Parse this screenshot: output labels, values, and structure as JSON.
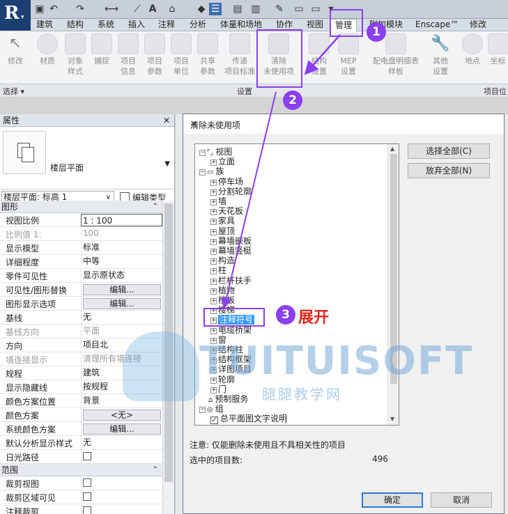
{
  "quick_access": {
    "icons": [
      "app-menu-icon",
      "open-icon",
      "save-icon",
      "undo-icon",
      "redo-icon",
      "measure-icon",
      "dimension-icon",
      "text-icon",
      "3d-view-icon",
      "section-icon",
      "thin-lines-icon",
      "close-hidden-icon",
      "switch-windows-icon",
      "customize-icon"
    ]
  },
  "ribbon_tabs": [
    "建筑",
    "结构",
    "系统",
    "插入",
    "注释",
    "分析",
    "体量和场地",
    "协作",
    "视图",
    "管理",
    "附加模块",
    "Enscape™",
    "修改"
  ],
  "active_tab": "管理",
  "ribbon_tools": [
    {
      "label": "修改"
    },
    {
      "label": "材质"
    },
    {
      "label": "对象\n样式"
    },
    {
      "label": "捕捉"
    },
    {
      "label": "项目\n信息"
    },
    {
      "label": "项目\n参数"
    },
    {
      "label": "项目\n单位"
    },
    {
      "label": "共享\n参数"
    },
    {
      "label": "传递\n项目标准"
    },
    {
      "label": "清除\n未使用项"
    },
    {
      "label": "结构\n设置"
    },
    {
      "label": "MEP\n设置"
    },
    {
      "label": "配电盘明细表\n样板"
    },
    {
      "label": "其他\n设置"
    },
    {
      "label": "地点"
    },
    {
      "label": "坐标"
    }
  ],
  "panel_bar": {
    "select": "选择 ▾",
    "settings": "设置",
    "project_location": "项目位"
  },
  "properties": {
    "title": "属性",
    "close": "✕",
    "type_name": "楼层平面",
    "instance": "楼层平面: 标高 1",
    "edit_type": "编辑类型",
    "groups": [
      {
        "name": "图形",
        "rows": [
          {
            "k": "视图比例",
            "v": "1 : 100",
            "kind": "boxed"
          },
          {
            "k": "比例值 1:",
            "v": "100",
            "kind": "dim"
          },
          {
            "k": "显示模型",
            "v": "标准"
          },
          {
            "k": "详细程度",
            "v": "中等"
          },
          {
            "k": "零件可见性",
            "v": "显示原状态"
          },
          {
            "k": "可见性/图形替换",
            "v": "编辑...",
            "kind": "btn"
          },
          {
            "k": "图形显示选项",
            "v": "编辑...",
            "kind": "btn"
          },
          {
            "k": "基线",
            "v": "无"
          },
          {
            "k": "基线方向",
            "v": "平面",
            "kind": "dim"
          },
          {
            "k": "方向",
            "v": "项目北"
          },
          {
            "k": "墙连接显示",
            "v": "清理所有墙连接",
            "kind": "dim"
          },
          {
            "k": "规程",
            "v": "建筑"
          },
          {
            "k": "显示隐藏线",
            "v": "按规程"
          },
          {
            "k": "颜色方案位置",
            "v": "背景"
          },
          {
            "k": "颜色方案",
            "v": "<无>",
            "kind": "btn"
          },
          {
            "k": "系统颜色方案",
            "v": "编辑...",
            "kind": "btn"
          },
          {
            "k": "默认分析显示样式",
            "v": "无"
          },
          {
            "k": "日光路径",
            "v": "",
            "kind": "cb"
          }
        ]
      },
      {
        "name": "范围",
        "rows": [
          {
            "k": "裁剪视图",
            "v": "",
            "kind": "cb"
          },
          {
            "k": "裁剪区域可见",
            "v": "",
            "kind": "cb"
          },
          {
            "k": "注释裁剪",
            "v": "",
            "kind": "cb"
          }
        ]
      }
    ]
  },
  "dialog": {
    "title": "清除未使用项",
    "close": "✕",
    "tree": [
      {
        "text": "视图",
        "level": 0,
        "exp": "−",
        "icon": "view"
      },
      {
        "text": "立面",
        "level": 1,
        "exp": "+"
      },
      {
        "text": "族",
        "level": 0,
        "exp": "−",
        "icon": "family"
      },
      {
        "text": "停车场",
        "level": 1,
        "exp": "+"
      },
      {
        "text": "分割轮廓",
        "level": 1,
        "exp": "+"
      },
      {
        "text": "墙",
        "level": 1,
        "exp": "+"
      },
      {
        "text": "天花板",
        "level": 1,
        "exp": "+"
      },
      {
        "text": "家具",
        "level": 1,
        "exp": "+"
      },
      {
        "text": "屋顶",
        "level": 1,
        "exp": "+"
      },
      {
        "text": "幕墙嵌板",
        "level": 1,
        "exp": "+"
      },
      {
        "text": "幕墙竖梃",
        "level": 1,
        "exp": "+"
      },
      {
        "text": "构造",
        "level": 1,
        "exp": "+"
      },
      {
        "text": "柱",
        "level": 1,
        "exp": "+"
      },
      {
        "text": "栏杆扶手",
        "level": 1,
        "exp": "+"
      },
      {
        "text": "植物",
        "level": 1,
        "exp": "+"
      },
      {
        "text": "楼板",
        "level": 1,
        "exp": "+"
      },
      {
        "text": "楼梯",
        "level": 1,
        "exp": "+"
      },
      {
        "text": "注释符号",
        "level": 1,
        "exp": "+",
        "selected": true
      },
      {
        "text": "电缆桥架",
        "level": 1,
        "exp": "+"
      },
      {
        "text": "窗",
        "level": 1,
        "exp": "+"
      },
      {
        "text": "结构柱",
        "level": 1,
        "exp": "+"
      },
      {
        "text": "结构框架",
        "level": 1,
        "exp": "+"
      },
      {
        "text": "详图项目",
        "level": 1,
        "exp": "+"
      },
      {
        "text": "轮廓",
        "level": 1,
        "exp": "+"
      },
      {
        "text": "门",
        "level": 1,
        "exp": "+"
      },
      {
        "text": "预制服务",
        "level": 0,
        "exp": "",
        "icon": "prefab"
      },
      {
        "text": "组",
        "level": 0,
        "exp": "−",
        "icon": "group"
      },
      {
        "text": "总平面图文字说明",
        "level": 1,
        "exp": "",
        "checked": true
      }
    ],
    "select_all": "选择全部(C)",
    "deselect_all": "放弃全部(N)",
    "note": "注意: 仅能删除未使用且不具相关性的项目",
    "count_label": "选中的项目数:",
    "count": "496",
    "ok": "确定",
    "cancel": "取消"
  },
  "annotations": {
    "step1": "1",
    "step2": "2",
    "step3": "3",
    "expand_label": "展开",
    "color": "#8a3ff0"
  },
  "watermark": {
    "brand": "TUITUISOFT",
    "cn": "腿腿教学网"
  }
}
